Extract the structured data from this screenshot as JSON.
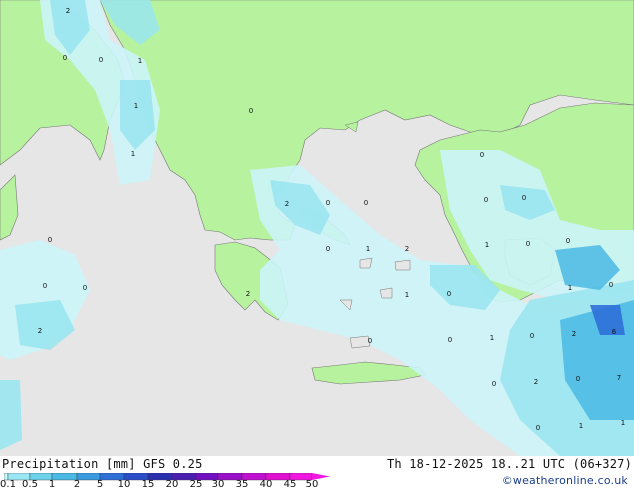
{
  "legend": {
    "title": "Precipitation [mm]",
    "model": "GFS 0.25",
    "ticks": [
      "0.1",
      "0.5",
      "1",
      "2",
      "5",
      "10",
      "15",
      "20",
      "25",
      "30",
      "35",
      "40",
      "45",
      "50"
    ],
    "colors": [
      "#c8f5fa",
      "#9ae6f2",
      "#6ed3ea",
      "#4ab9e3",
      "#3a9ae0",
      "#2f6fd8",
      "#2a4ec8",
      "#2a2fb0",
      "#4a1fb0",
      "#7010c0",
      "#9a10c8",
      "#c010d0",
      "#e010d0",
      "#f018e0"
    ]
  },
  "datetime": "Th 18-12-2025 18..21 UTC (06+327)",
  "credit": "©weatheronline.co.uk",
  "colors": {
    "land": "#b7f29f",
    "sea": "#e6e6e6",
    "border": "#888888",
    "light_precip": "#ccf4f8",
    "mid_precip": "#9ae6f0",
    "heavy_precip": "#4ab8e4"
  },
  "map_values": [
    "2",
    "0",
    "0",
    "1",
    "0",
    "1",
    "1",
    "0",
    "0",
    "0",
    "0",
    "2",
    "2",
    "0",
    "0",
    "0",
    "0",
    "1",
    "0",
    "0",
    "1",
    "2",
    "1",
    "0",
    "2",
    "0",
    "0",
    "1",
    "0",
    "1",
    "0",
    "2",
    "6",
    "0",
    "2",
    "7",
    "0",
    "0",
    "0",
    "1",
    "1"
  ]
}
